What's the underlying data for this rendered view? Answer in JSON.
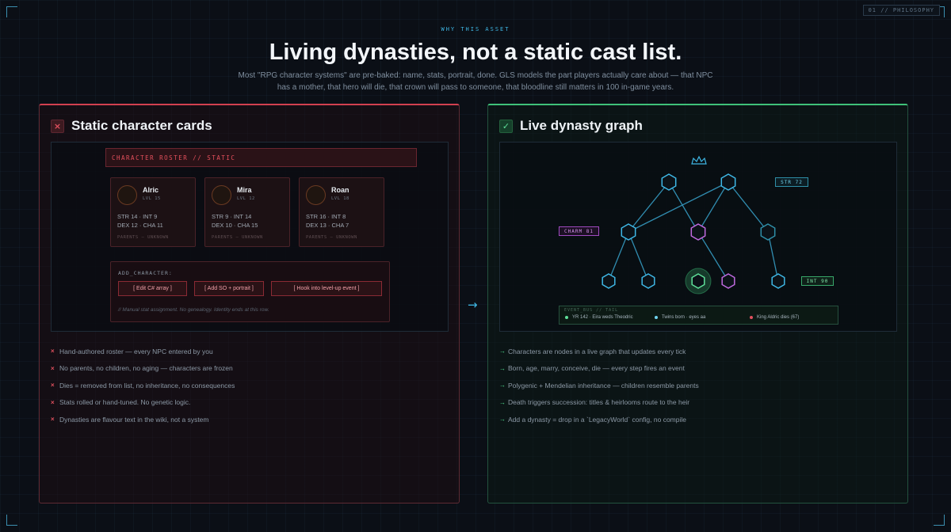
{
  "section_tag": "01 // PHILOSOPHY",
  "eyebrow": "WHY THIS ASSET",
  "title": "Living dynasties, not a static cast list.",
  "subtitle": "Most \"RPG character systems\" are pre-baked: name, stats, portrait, done. GLS models the part players actually care about — that NPC has a mother, that hero will die, that crown will pass to someone, that bloodline still matters in 100 in-game years.",
  "colors": {
    "accent_cyan": "#3fb8e6",
    "static_red": "#d2404f",
    "live_green": "#3fc179",
    "charm_purple": "#c06ae0"
  },
  "left": {
    "badge": "×",
    "title": "Static character cards",
    "roster_header": "CHARACTER ROSTER // STATIC",
    "cards": [
      {
        "name": "Alric",
        "level": "LVL 15",
        "stats_1": "STR 14 · INT 9",
        "stats_2": "DEX 12 · CHA 11",
        "parents": "PARENTS — UNKNOWN"
      },
      {
        "name": "Mira",
        "level": "LVL 12",
        "stats_1": "STR 9 · INT 14",
        "stats_2": "DEX 10 · CHA 15",
        "parents": "PARENTS — UNKNOWN"
      },
      {
        "name": "Roan",
        "level": "LVL 18",
        "stats_1": "STR 16 · INT 8",
        "stats_2": "DEX 13 · CHA 7",
        "parents": "PARENTS — UNKNOWN"
      }
    ],
    "add_label": "ADD_CHARACTER:",
    "buttons": [
      "[ Edit C# array ]",
      "[ Add SO + portrait ]",
      "[ Hook into level-up event ]"
    ],
    "note": "// Manual stat assignment. No genealogy. Identity ends at this row.",
    "bullets": [
      "Hand-authored roster — every NPC entered by you",
      "No parents, no children, no aging — characters are frozen",
      "Dies = removed from list, no inheritance, no consequences",
      "Stats rolled or hand-tuned. No genetic logic.",
      "Dynasties are flavour text in the wiki, not a system"
    ]
  },
  "flow_arrow": "→",
  "right": {
    "badge": "✓",
    "title": "Live dynasty graph",
    "crown_icon": "crown-icon",
    "tags": {
      "str": "STR 72",
      "charm": "CHARM 81",
      "int": "INT 90"
    },
    "event_label": "EVENT_BUS // TAIL",
    "events": [
      {
        "text": "YR 142 · Eira weds Theodric",
        "color": "#5fe09a"
      },
      {
        "text": "Twins born · eyes aa",
        "color": "#6fd2ee"
      },
      {
        "text": "King Aldric dies (67)",
        "color": "#e0505e"
      }
    ],
    "bullets": [
      "Characters are nodes in a live graph that updates every tick",
      "Born, age, marry, conceive, die — every step fires an event",
      "Polygenic + Mendelian inheritance — children resemble parents",
      "Death triggers succession: titles & heirlooms route to the heir",
      "Add a dynasty = drop in a `LegacyWorld` config, no compile"
    ]
  }
}
